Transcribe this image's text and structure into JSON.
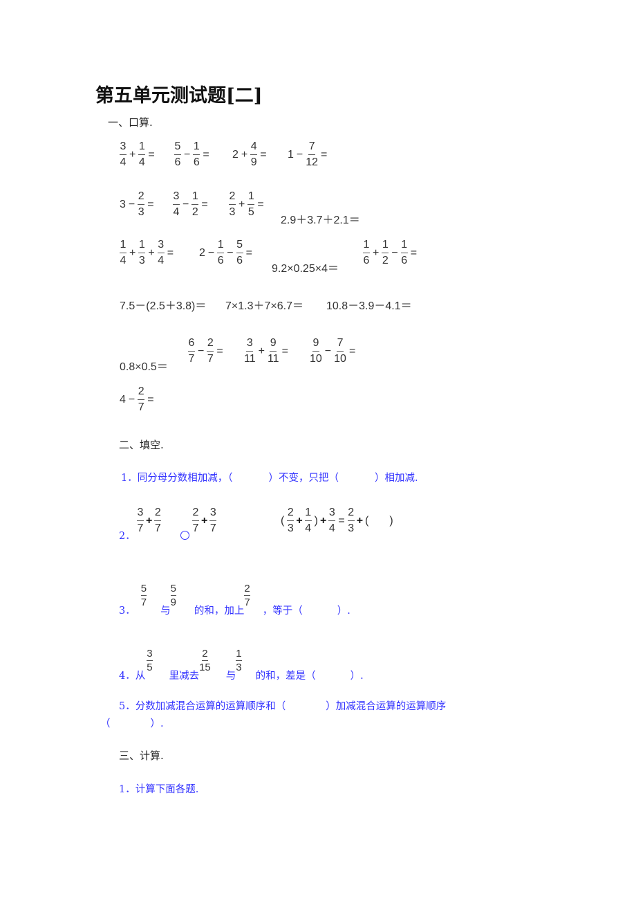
{
  "title": "第五单元测试题[二]",
  "sections": {
    "s1": {
      "heading": "一、口算.",
      "rows": [
        [
          {
            "terms": [
              {
                "n": "3",
                "d": "4"
              },
              "+",
              {
                "n": "1",
                "d": "4"
              },
              "="
            ]
          },
          {
            "terms": [
              {
                "n": "5",
                "d": "6"
              },
              "−",
              {
                "n": "1",
                "d": "6"
              },
              "="
            ]
          },
          {
            "terms": [
              "2",
              "+",
              {
                "n": "4",
                "d": "9"
              },
              "="
            ]
          },
          {
            "terms": [
              "1",
              "−",
              {
                "n": "7",
                "d": "12"
              },
              "="
            ]
          }
        ],
        [
          {
            "terms": [
              "3",
              "−",
              {
                "n": "2",
                "d": "3"
              },
              "="
            ]
          },
          {
            "terms": [
              {
                "n": "3",
                "d": "4"
              },
              "−",
              {
                "n": "1",
                "d": "2"
              },
              "="
            ]
          },
          {
            "terms": [
              {
                "n": "2",
                "d": "3"
              },
              "+",
              {
                "n": "1",
                "d": "5"
              },
              "="
            ]
          },
          {
            "terms": [
              "2.9＋3.7＋2.1＝"
            ]
          }
        ],
        [
          {
            "terms": [
              {
                "n": "1",
                "d": "4"
              },
              "+",
              {
                "n": "1",
                "d": "3"
              },
              "+",
              {
                "n": "3",
                "d": "4"
              },
              "="
            ]
          },
          {
            "terms": [
              "2",
              "−",
              {
                "n": "1",
                "d": "6"
              },
              "−",
              {
                "n": "5",
                "d": "6"
              },
              "="
            ]
          },
          {
            "terms": [
              "9.2×0.25×4＝"
            ]
          },
          {
            "terms": [
              {
                "n": "1",
                "d": "6"
              },
              "+",
              {
                "n": "1",
                "d": "2"
              },
              "−",
              {
                "n": "1",
                "d": "6"
              },
              "="
            ]
          }
        ],
        [
          {
            "terms": [
              "7.5－(2.5＋3.8)＝"
            ]
          },
          {
            "terms": [
              "7×1.3＋7×6.7＝"
            ]
          },
          {
            "terms": [
              "10.8－3.9－4.1＝"
            ]
          }
        ],
        [
          {
            "terms": [
              "0.8×0.5＝"
            ]
          },
          {
            "terms": [
              {
                "n": "6",
                "d": "7"
              },
              "−",
              {
                "n": "2",
                "d": "7"
              },
              "="
            ]
          },
          {
            "terms": [
              {
                "n": "3",
                "d": "11"
              },
              "+",
              {
                "n": "9",
                "d": "11"
              },
              "="
            ]
          },
          {
            "terms": [
              {
                "n": "9",
                "d": "10"
              },
              "−",
              {
                "n": "7",
                "d": "10"
              },
              "="
            ]
          }
        ],
        [
          {
            "terms": [
              "4",
              "−",
              {
                "n": "2",
                "d": "7"
              },
              "="
            ]
          }
        ]
      ]
    },
    "s2": {
      "heading": "二、填空.",
      "q1": {
        "num": "1．",
        "a": "同分母分数相加减，（",
        "b": "）不变，只把（",
        "c": "）相加减."
      },
      "q2": {
        "num": "2．",
        "left": [
          {
            "n": "3",
            "d": "7"
          },
          "+",
          {
            "n": "2",
            "d": "7"
          }
        ],
        "right": [
          {
            "n": "2",
            "d": "7"
          },
          "+",
          {
            "n": "3",
            "d": "7"
          }
        ],
        "eq": [
          "(",
          {
            "n": "2",
            "d": "3"
          },
          "+",
          {
            "n": "1",
            "d": "4"
          },
          ")",
          "+",
          {
            "n": "3",
            "d": "4"
          },
          "=",
          {
            "n": "2",
            "d": "3"
          },
          "+",
          "(",
          ")"
        ]
      },
      "q3": {
        "num": "3．",
        "f1": {
          "n": "5",
          "d": "7"
        },
        "t1": "与",
        "f2": {
          "n": "5",
          "d": "9"
        },
        "t2": "的和，加上",
        "f3": {
          "n": "2",
          "d": "7"
        },
        "t3": "，等于（",
        "t4": "）."
      },
      "q4": {
        "num": "4．从",
        "f1": {
          "n": "3",
          "d": "5"
        },
        "t1": "里减去",
        "f2": {
          "n": "2",
          "d": "15"
        },
        "t2": "与",
        "f3": {
          "n": "1",
          "d": "3"
        },
        "t3": "的和，差是（",
        "t4": "）."
      },
      "q5": {
        "line1": "5．分数加减混合运算的运算顺序和（　　　　）加减混合运算的运算顺序",
        "line2": "（　　　　）."
      }
    },
    "s3": {
      "heading": "三、计算.",
      "q1": "1．计算下面各题."
    },
    "colors": {
      "question_blue": "#3333ff",
      "text": "#222222"
    }
  }
}
